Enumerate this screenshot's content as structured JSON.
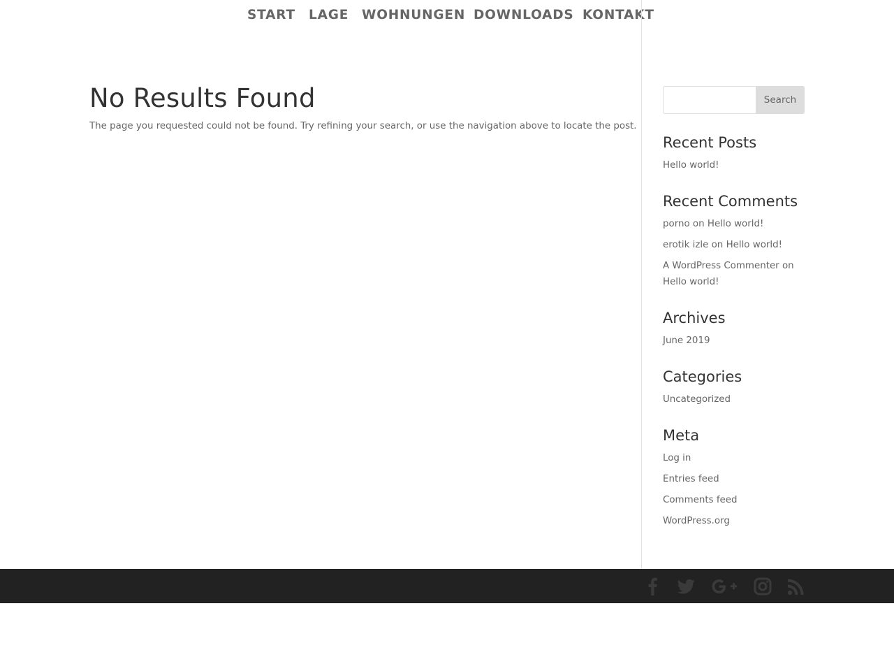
{
  "nav": {
    "items": [
      {
        "label": "START"
      },
      {
        "label": "LAGE"
      },
      {
        "label": "WOHNUNGEN"
      },
      {
        "label": "DOWNLOADS"
      },
      {
        "label": "KONTAKT"
      }
    ]
  },
  "main": {
    "title": "No Results Found",
    "message": "The page you requested could not be found. Try refining your search, or use the navigation above to locate the post."
  },
  "sidebar": {
    "search": {
      "value": "",
      "placeholder": "",
      "button_label": "Search"
    },
    "recent_posts": {
      "title": "Recent Posts",
      "items": [
        {
          "label": "Hello world!"
        }
      ]
    },
    "recent_comments": {
      "title": "Recent Comments",
      "items": [
        {
          "author": "porno",
          "connector": "on",
          "post": "Hello world!"
        },
        {
          "author": "erotik izle",
          "connector": "on",
          "post": "Hello world!"
        },
        {
          "author": "A WordPress Commenter",
          "connector": "on",
          "post": "Hello world!"
        }
      ]
    },
    "archives": {
      "title": "Archives",
      "items": [
        {
          "label": "June 2019"
        }
      ]
    },
    "categories": {
      "title": "Categories",
      "items": [
        {
          "label": "Uncategorized"
        }
      ]
    },
    "meta": {
      "title": "Meta",
      "items": [
        {
          "label": "Log in"
        },
        {
          "label": "Entries feed"
        },
        {
          "label": "Comments feed"
        },
        {
          "label": "WordPress.org"
        }
      ]
    }
  },
  "footer": {
    "social_icons": [
      "facebook-icon",
      "twitter-icon",
      "google-plus-icon",
      "instagram-icon",
      "rss-icon"
    ]
  },
  "colors": {
    "text": "#666666",
    "heading": "#333333",
    "footer_bg": "#222222",
    "search_button_bg": "#dddddd",
    "divider": "#e2e2e2",
    "footer_icon": "#3a3a3a"
  }
}
